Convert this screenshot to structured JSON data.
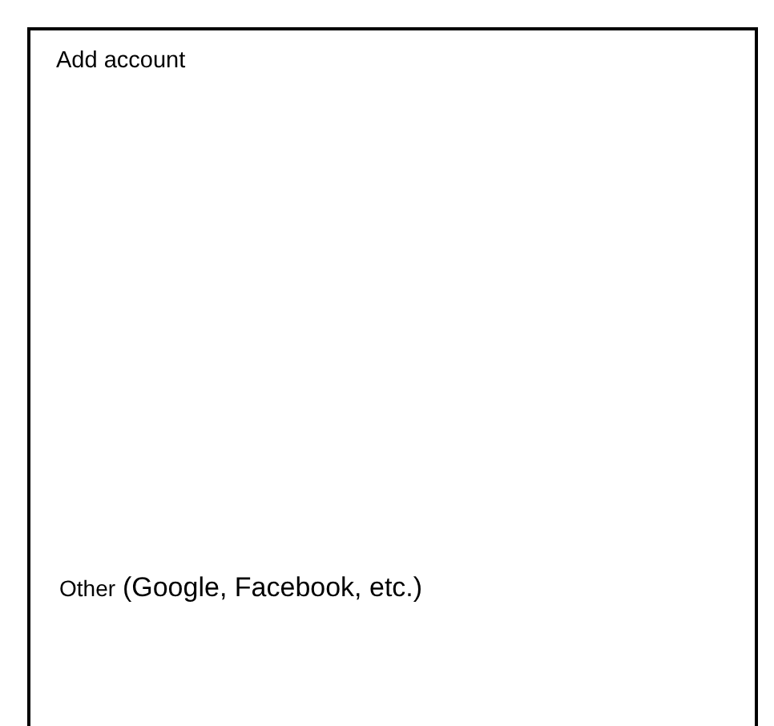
{
  "panel": {
    "title": "Add account"
  },
  "options": [
    {
      "label": "Other",
      "detail": "(Google, Facebook, etc.)"
    }
  ]
}
